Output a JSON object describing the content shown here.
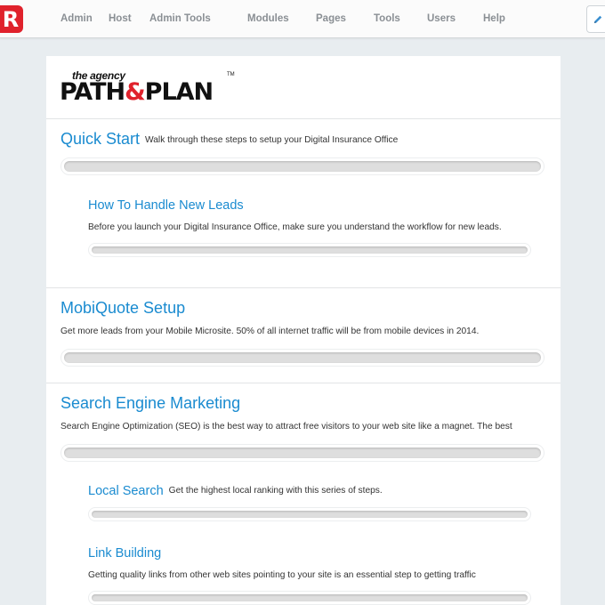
{
  "nav": {
    "logo_letter": "R",
    "items": [
      "Admin",
      "Host",
      "Admin Tools",
      "Modules",
      "Pages",
      "Tools",
      "Users",
      "Help"
    ]
  },
  "brand": {
    "tagline": "the agency",
    "word1": "PATH",
    "amp": "&",
    "word2": "PLAN",
    "tm": "TM"
  },
  "sections": {
    "quick_start": {
      "title": "Quick Start",
      "desc": "Walk through these steps to setup your Digital Insurance Office",
      "progress": 0
    },
    "new_leads": {
      "title": "How To Handle New Leads",
      "desc": "Before you launch your Digital Insurance Office, make sure you understand the workflow for new leads.",
      "progress": 0
    },
    "mobiquote": {
      "title": "MobiQuote Setup",
      "desc": "Get more leads from your Mobile Microsite. 50% of all internet traffic will be from mobile devices in 2014.",
      "progress": 0
    },
    "sem": {
      "title": "Search Engine Marketing",
      "desc": "Search Engine Optimization (SEO) is the best way to attract free visitors to your web site like a magnet. The best",
      "progress": 0
    },
    "local_search": {
      "title": "Local Search",
      "desc": "Get the highest local ranking with this series of steps.",
      "progress": 0
    },
    "link_building": {
      "title": "Link Building",
      "desc": "Getting quality links from other web sites pointing to your site is an essential step to getting traffic",
      "progress": 0
    }
  },
  "colors": {
    "accent": "#1a8bd0",
    "brand_red": "#e0222c"
  }
}
